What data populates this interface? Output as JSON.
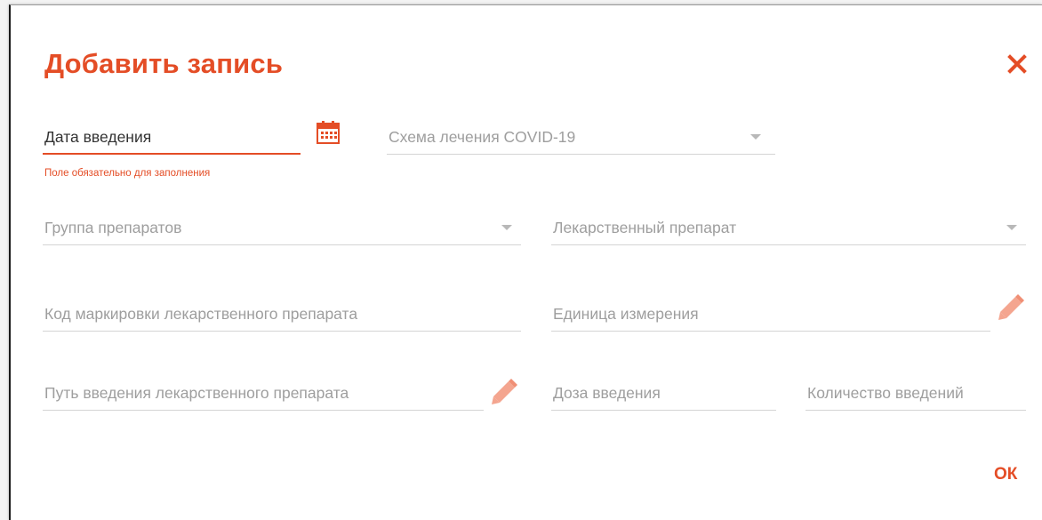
{
  "dialog": {
    "title": "Добавить запись",
    "close_icon": "close-icon",
    "ok_label": "ОК"
  },
  "fields": {
    "date": {
      "value": "Дата введения",
      "error": "Поле обязательно для заполнения",
      "icon": "calendar-icon"
    },
    "covid_scheme": {
      "placeholder": "Схема лечения COVID-19"
    },
    "drug_group": {
      "placeholder": "Группа препаратов"
    },
    "drug": {
      "placeholder": "Лекарственный препарат"
    },
    "marking_code": {
      "placeholder": "Код маркировки лекарственного препарата"
    },
    "unit": {
      "placeholder": "Единица измерения",
      "icon": "pencil-icon"
    },
    "route": {
      "placeholder": "Путь введения лекарственного препарата",
      "icon": "pencil-icon"
    },
    "dose": {
      "placeholder": "Доза введения"
    },
    "count": {
      "placeholder": "Количество введений"
    }
  },
  "colors": {
    "accent": "#e44d26",
    "placeholder": "#9e9e9e",
    "underline": "#d4d4d4"
  }
}
